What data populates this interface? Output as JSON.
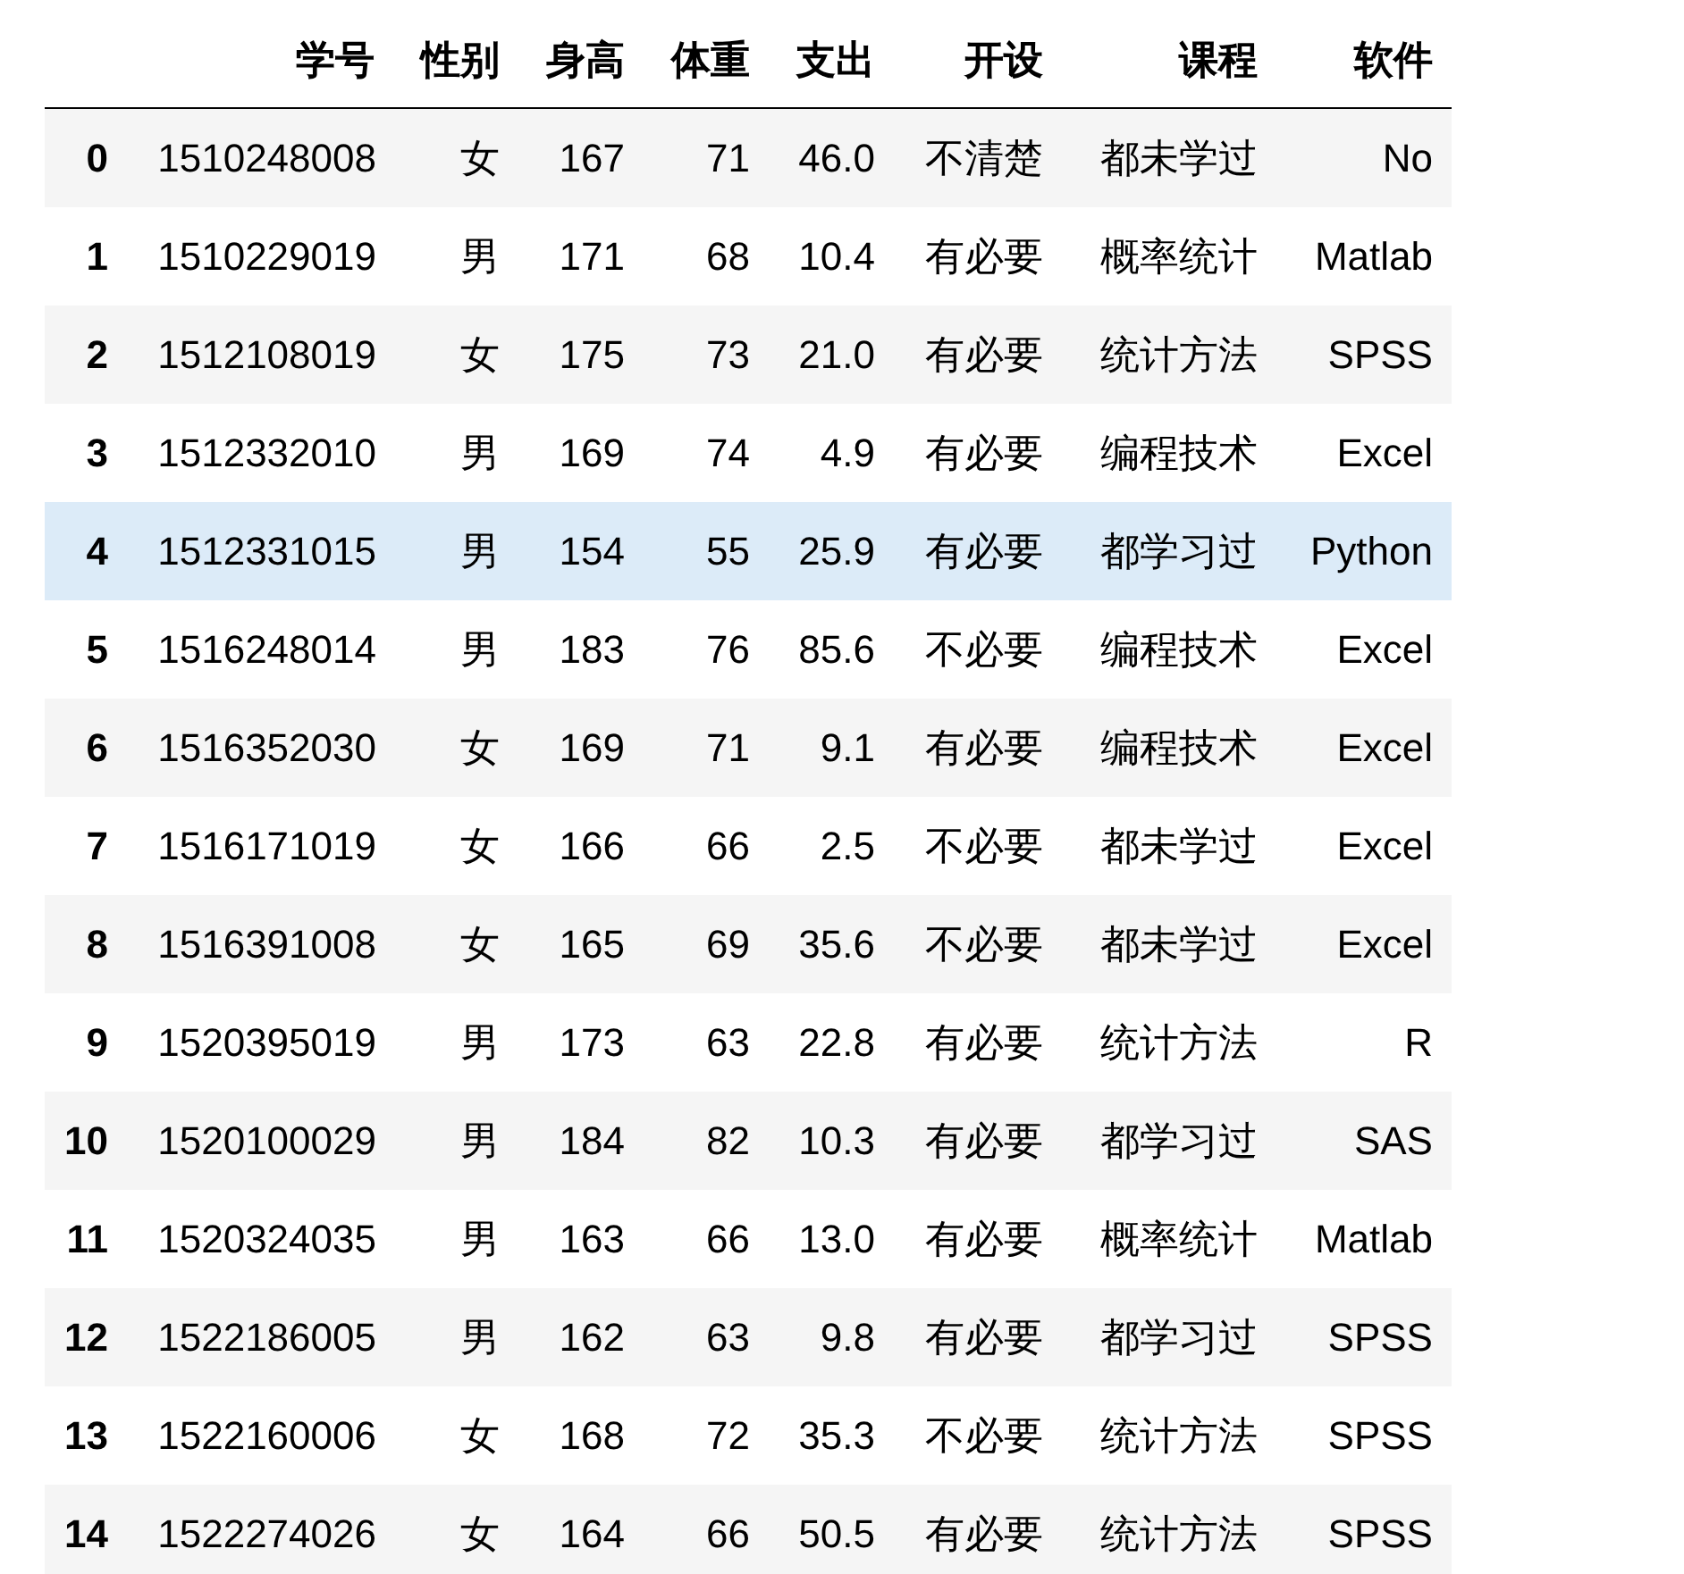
{
  "table": {
    "columns": [
      "学号",
      "性别",
      "身高",
      "体重",
      "支出",
      "开设",
      "课程",
      "软件"
    ],
    "rows": [
      {
        "index": "0",
        "cells": [
          "1510248008",
          "女",
          "167",
          "71",
          "46.0",
          "不清楚",
          "都未学过",
          "No"
        ],
        "hovered": false
      },
      {
        "index": "1",
        "cells": [
          "1510229019",
          "男",
          "171",
          "68",
          "10.4",
          "有必要",
          "概率统计",
          "Matlab"
        ],
        "hovered": false
      },
      {
        "index": "2",
        "cells": [
          "1512108019",
          "女",
          "175",
          "73",
          "21.0",
          "有必要",
          "统计方法",
          "SPSS"
        ],
        "hovered": false
      },
      {
        "index": "3",
        "cells": [
          "1512332010",
          "男",
          "169",
          "74",
          "4.9",
          "有必要",
          "编程技术",
          "Excel"
        ],
        "hovered": false
      },
      {
        "index": "4",
        "cells": [
          "1512331015",
          "男",
          "154",
          "55",
          "25.9",
          "有必要",
          "都学习过",
          "Python"
        ],
        "hovered": true
      },
      {
        "index": "5",
        "cells": [
          "1516248014",
          "男",
          "183",
          "76",
          "85.6",
          "不必要",
          "编程技术",
          "Excel"
        ],
        "hovered": false
      },
      {
        "index": "6",
        "cells": [
          "1516352030",
          "女",
          "169",
          "71",
          "9.1",
          "有必要",
          "编程技术",
          "Excel"
        ],
        "hovered": false
      },
      {
        "index": "7",
        "cells": [
          "1516171019",
          "女",
          "166",
          "66",
          "2.5",
          "不必要",
          "都未学过",
          "Excel"
        ],
        "hovered": false
      },
      {
        "index": "8",
        "cells": [
          "1516391008",
          "女",
          "165",
          "69",
          "35.6",
          "不必要",
          "都未学过",
          "Excel"
        ],
        "hovered": false
      },
      {
        "index": "9",
        "cells": [
          "1520395019",
          "男",
          "173",
          "63",
          "22.8",
          "有必要",
          "统计方法",
          "R"
        ],
        "hovered": false
      },
      {
        "index": "10",
        "cells": [
          "1520100029",
          "男",
          "184",
          "82",
          "10.3",
          "有必要",
          "都学习过",
          "SAS"
        ],
        "hovered": false
      },
      {
        "index": "11",
        "cells": [
          "1520324035",
          "男",
          "163",
          "66",
          "13.0",
          "有必要",
          "概率统计",
          "Matlab"
        ],
        "hovered": false
      },
      {
        "index": "12",
        "cells": [
          "1522186005",
          "男",
          "162",
          "63",
          "9.8",
          "有必要",
          "都学习过",
          "SPSS"
        ],
        "hovered": false
      },
      {
        "index": "13",
        "cells": [
          "1522160006",
          "女",
          "168",
          "72",
          "35.3",
          "不必要",
          "统计方法",
          "SPSS"
        ],
        "hovered": false
      },
      {
        "index": "14",
        "cells": [
          "1522274026",
          "女",
          "164",
          "66",
          "50.5",
          "有必要",
          "统计方法",
          "SPSS"
        ],
        "hovered": false
      }
    ]
  }
}
